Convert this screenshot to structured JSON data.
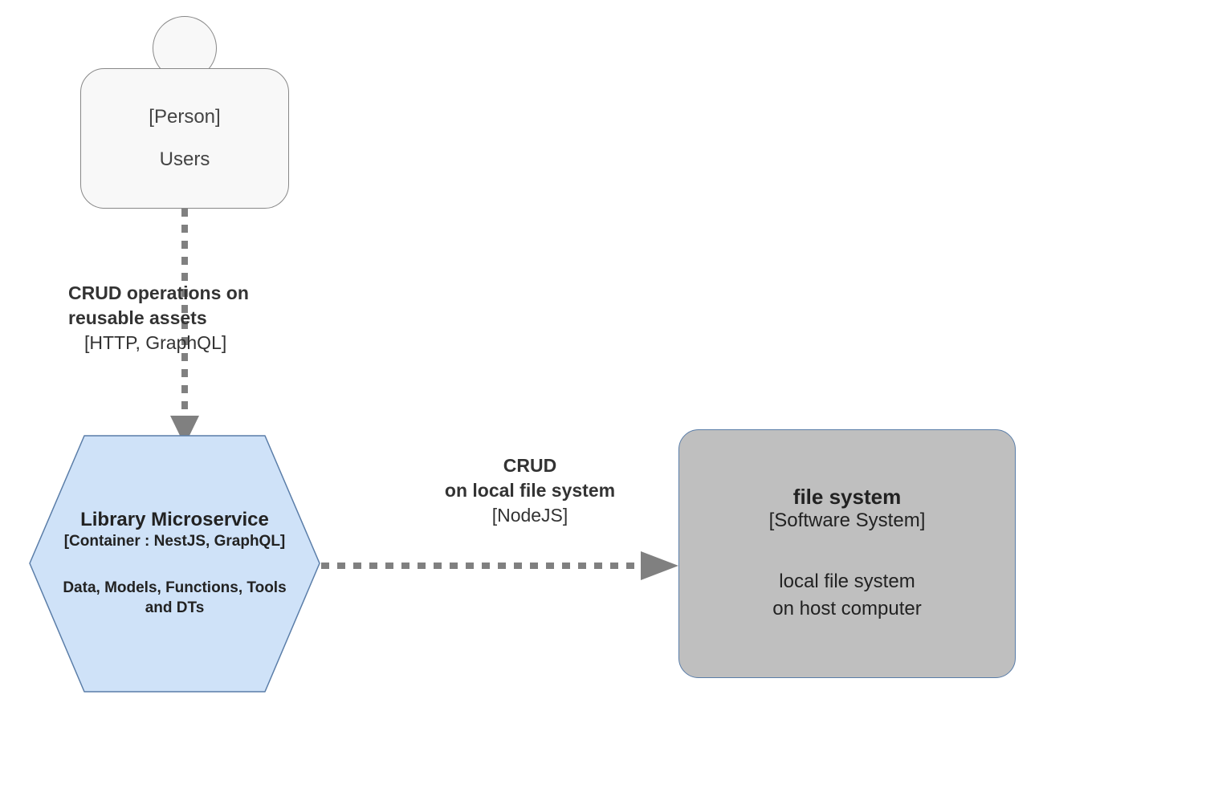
{
  "actors": {
    "person": {
      "label": "[Person]",
      "name": "Users"
    }
  },
  "nodes": {
    "library": {
      "title": "Library Microservice",
      "subtitle": "[Container : NestJS, GraphQL]",
      "description": "Data, Models, Functions, Tools and DTs"
    },
    "filesystem": {
      "title": "file system",
      "subtitle": "[Software System]",
      "description_line1": "local file system",
      "description_line2": "on host computer"
    }
  },
  "edges": {
    "user_to_library": {
      "label_line1": "CRUD operations on",
      "label_line2": "reusable assets",
      "tech": "[HTTP, GraphQL]"
    },
    "library_to_fs": {
      "label_line1": "CRUD",
      "label_line2": "on local file system",
      "tech": "[NodeJS]"
    }
  }
}
